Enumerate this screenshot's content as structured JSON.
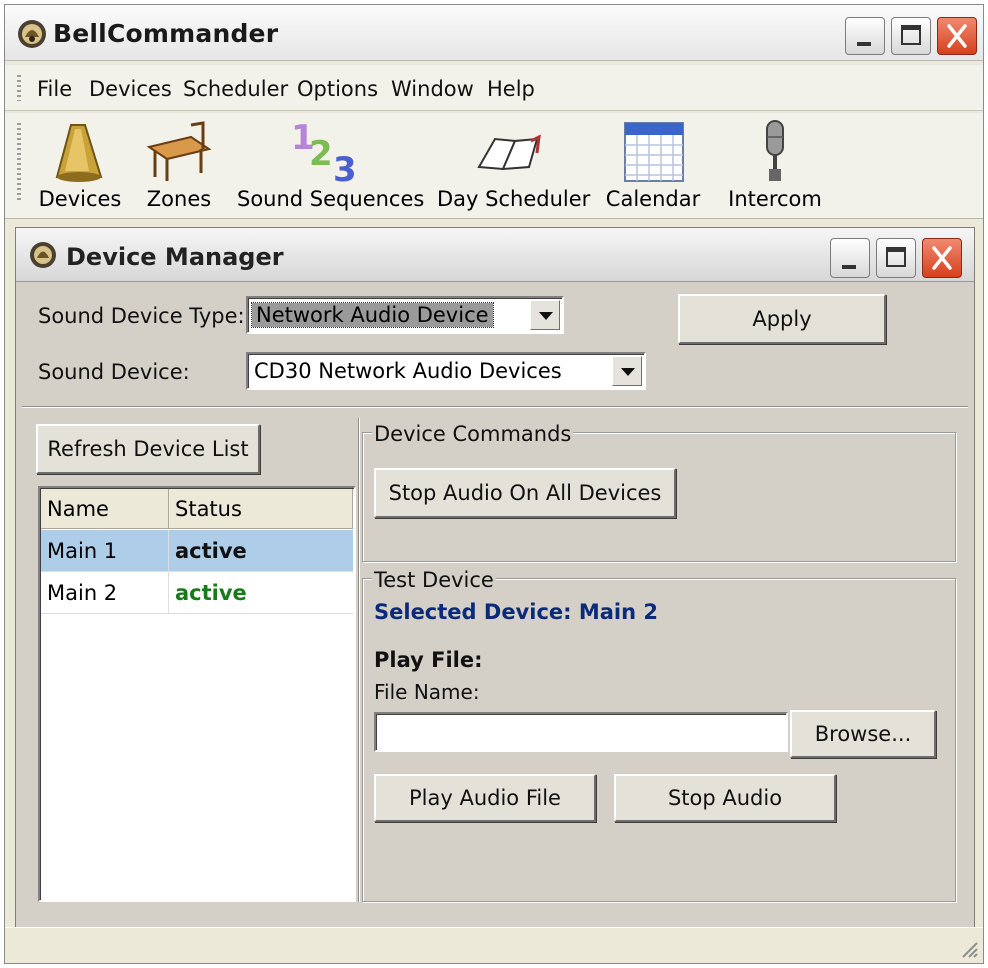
{
  "window": {
    "title": "BellCommander",
    "controls": [
      "minimize",
      "maximize",
      "close"
    ]
  },
  "menu": {
    "items": [
      "File",
      "Devices",
      "Scheduler",
      "Options",
      "Window",
      "Help"
    ]
  },
  "toolbar": {
    "items": [
      {
        "label": "Devices",
        "icon": "speaker-horn-icon"
      },
      {
        "label": "Zones",
        "icon": "school-desk-icon"
      },
      {
        "label": "Sound Sequences",
        "icon": "numbers-123-icon"
      },
      {
        "label": "Day Scheduler",
        "icon": "open-book-icon"
      },
      {
        "label": "Calendar",
        "icon": "calendar-icon"
      },
      {
        "label": "Intercom",
        "icon": "microphone-icon"
      }
    ]
  },
  "device_manager": {
    "title": "Device Manager",
    "sound_device_type": {
      "label": "Sound Device Type:",
      "value": "Network Audio Device"
    },
    "sound_device": {
      "label": "Sound Device:",
      "value": "CD30 Network Audio Devices"
    },
    "apply_label": "Apply",
    "refresh_label": "Refresh Device List",
    "device_list": {
      "columns": [
        "Name",
        "Status"
      ],
      "rows": [
        {
          "name": "Main 1",
          "status": "active",
          "selected": true
        },
        {
          "name": "Main 2",
          "status": "active",
          "selected": false
        }
      ]
    },
    "device_commands": {
      "title": "Device Commands",
      "stop_all_label": "Stop Audio On All Devices"
    },
    "test_device": {
      "title": "Test Device",
      "selected_device": "Selected Device: Main 2",
      "play_file_heading": "Play File:",
      "file_name_label": "File Name:",
      "file_name_value": "",
      "browse_label": "Browse...",
      "play_label": "Play Audio File",
      "stop_label": "Stop Audio"
    }
  },
  "colors": {
    "selected_device_text": "#0b2a7a",
    "status_active": "#1a7a1a",
    "row_selected": "#aecde9",
    "close_button": "#d6401e",
    "face": "#d4d0c8"
  }
}
